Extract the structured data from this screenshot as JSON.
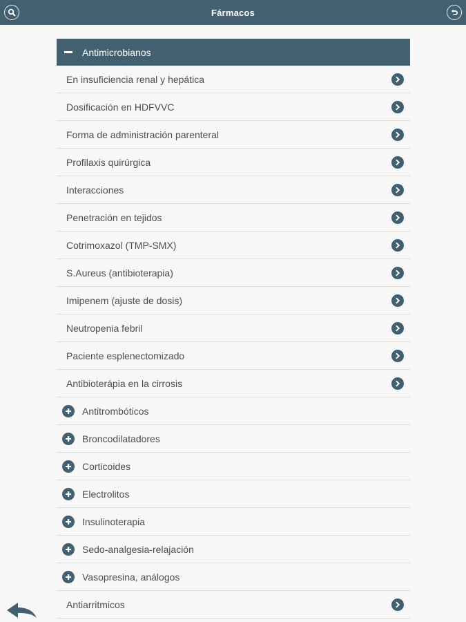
{
  "header": {
    "title": "Fármacos",
    "search_icon": "search-icon",
    "refresh_icon": "undo-icon"
  },
  "expanded_section": {
    "label": "Antimicrobianos",
    "items": [
      {
        "label": "En insuficiencia renal y hepática"
      },
      {
        "label": "Dosificación en HDFVVC"
      },
      {
        "label": "Forma de administración parenteral"
      },
      {
        "label": "Profilaxis quirúrgica"
      },
      {
        "label": "Interacciones"
      },
      {
        "label": "Penetración en tejidos"
      },
      {
        "label": "Cotrimoxazol (TMP-SMX)"
      },
      {
        "label": "S.Aureus (antibioterapia)"
      },
      {
        "label": "Imipenem (ajuste de dosis)"
      },
      {
        "label": "Neutropenia febril"
      },
      {
        "label": "Paciente esplenectomizado"
      },
      {
        "label": "Antibioterápia en la cirrosis"
      }
    ]
  },
  "collapsed_sections": [
    {
      "label": "Antitrombóticos"
    },
    {
      "label": "Broncodilatadores"
    },
    {
      "label": "Corticoides"
    },
    {
      "label": "Electrolitos"
    },
    {
      "label": "Insulinoterapia"
    },
    {
      "label": "Sedo-analgesia-relajación"
    },
    {
      "label": "Vasopresina, análogos"
    }
  ],
  "trailing_items": [
    {
      "label": "Antiarritmicos"
    }
  ],
  "colors": {
    "accent": "#436070",
    "background": "#f7f7f7"
  },
  "back_icon": "back-arrow-icon"
}
